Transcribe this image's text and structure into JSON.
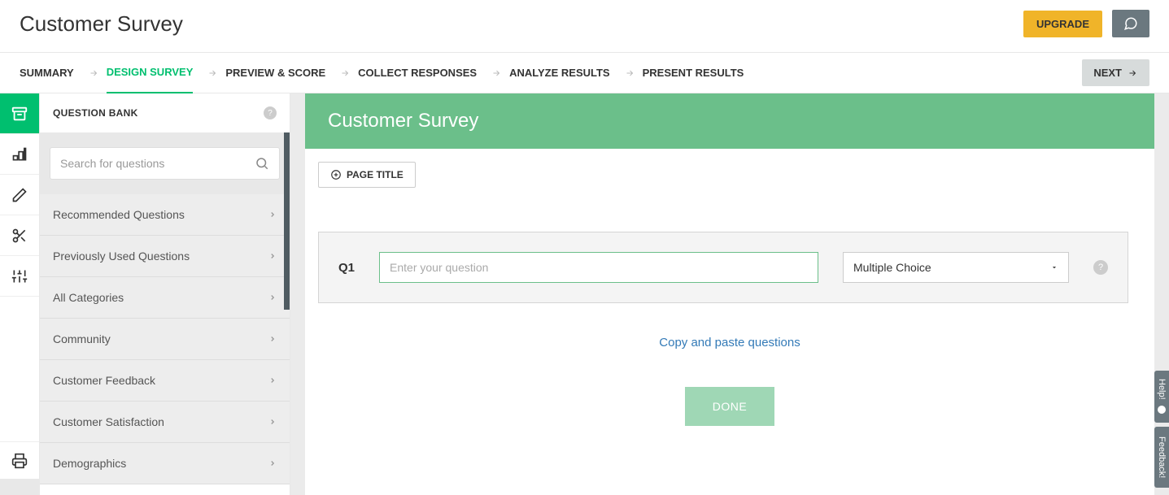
{
  "header": {
    "title": "Customer Survey",
    "upgrade_label": "UPGRADE"
  },
  "steps": {
    "items": [
      "SUMMARY",
      "DESIGN SURVEY",
      "PREVIEW & SCORE",
      "COLLECT RESPONSES",
      "ANALYZE RESULTS",
      "PRESENT RESULTS"
    ],
    "active_index": 1,
    "next_label": "NEXT"
  },
  "sidebar": {
    "title": "QUESTION BANK",
    "search_placeholder": "Search for questions",
    "categories": [
      "Recommended Questions",
      "Previously Used Questions",
      "All Categories",
      "Community",
      "Customer Feedback",
      "Customer Satisfaction",
      "Demographics"
    ]
  },
  "survey": {
    "banner_title": "Customer Survey",
    "page_title_button": "PAGE TITLE",
    "q_number": "Q1",
    "q_placeholder": "Enter your question",
    "q_type_selected": "Multiple Choice",
    "copy_link": "Copy and paste questions",
    "done_label": "DONE"
  },
  "float": {
    "help": "Help!",
    "feedback": "Feedback!"
  }
}
